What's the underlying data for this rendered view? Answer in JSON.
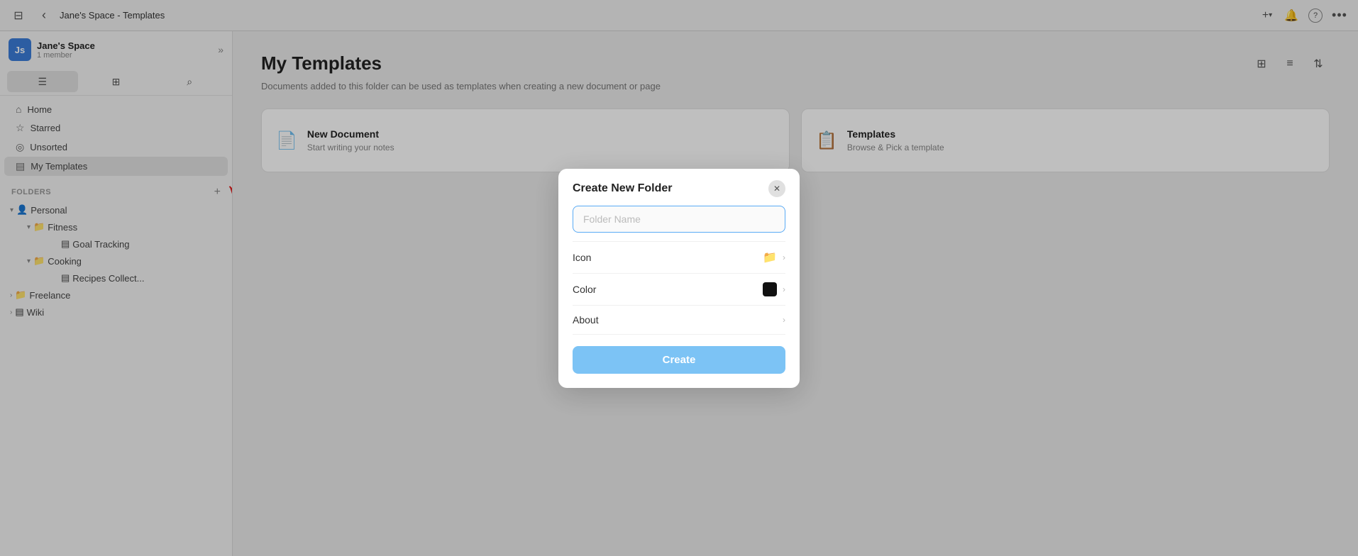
{
  "topbar": {
    "toggle_sidebar_icon": "☰",
    "back_icon": "‹",
    "title": "Jane's Space - Templates",
    "add_icon": "+",
    "add_dropdown_icon": "▾",
    "notifications_icon": "🔔",
    "help_icon": "?",
    "more_icon": "•••"
  },
  "sidebar": {
    "workspace": {
      "initials": "Js",
      "name": "Jane's Space",
      "sub": "1 member"
    },
    "tools": [
      {
        "id": "list",
        "icon": "☰"
      },
      {
        "id": "calendar",
        "icon": "⊞"
      },
      {
        "id": "search",
        "icon": "⌕"
      }
    ],
    "nav_items": [
      {
        "id": "home",
        "icon": "⌂",
        "label": "Home"
      },
      {
        "id": "starred",
        "icon": "☆",
        "label": "Starred"
      },
      {
        "id": "unsorted",
        "icon": "◎",
        "label": "Unsorted"
      },
      {
        "id": "my-templates",
        "icon": "▤",
        "label": "My Templates"
      }
    ],
    "folders_label": "Folders",
    "folders_add_icon": "+",
    "folders": [
      {
        "id": "personal",
        "name": "Personal",
        "icon": "👤",
        "color": "purple",
        "expanded": true,
        "children": [
          {
            "id": "fitness",
            "name": "Fitness",
            "icon": "📁",
            "color": "blue",
            "expanded": true,
            "children": [
              {
                "id": "goal-tracking",
                "name": "Goal Tracking",
                "icon": "▤"
              }
            ]
          },
          {
            "id": "cooking",
            "name": "Cooking",
            "icon": "📁",
            "color": "blue",
            "expanded": true,
            "children": [
              {
                "id": "recipes",
                "name": "Recipes Collect...",
                "icon": "▤"
              }
            ]
          }
        ]
      },
      {
        "id": "freelance",
        "name": "Freelance",
        "icon": "📁",
        "color": "blue",
        "expanded": false
      },
      {
        "id": "wiki",
        "name": "Wiki",
        "icon": "▤",
        "color": "dark",
        "expanded": false
      }
    ]
  },
  "content": {
    "title": "My Templates",
    "subtitle": "Documents added to this folder can be used as templates when creating a new document or page",
    "toolbar": {
      "grid_icon": "⊞",
      "list_icon": "≡",
      "sort_icon": "⇅"
    },
    "cards": [
      {
        "id": "new-doc",
        "icon": "📄",
        "title": "New Document",
        "desc": "Start writing your notes"
      },
      {
        "id": "templates",
        "icon": "📋",
        "title": "Templates",
        "desc": "Browse & Pick a template"
      }
    ]
  },
  "modal": {
    "title": "Create New Folder",
    "close_icon": "✕",
    "input_placeholder": "Folder Name",
    "rows": [
      {
        "id": "icon",
        "label": "Icon",
        "icon_preview": "📁",
        "has_chevron": true
      },
      {
        "id": "color",
        "label": "Color",
        "color_swatch": "#111111",
        "has_chevron": true
      },
      {
        "id": "about",
        "label": "About",
        "has_chevron": true
      }
    ],
    "create_button": "Create"
  }
}
